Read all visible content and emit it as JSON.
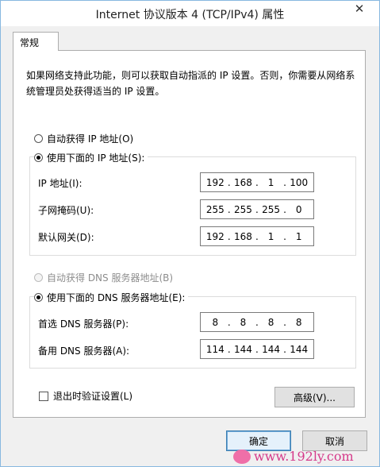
{
  "window": {
    "title": "Internet 协议版本 4 (TCP/IPv4) 属性",
    "close_glyph": "✕"
  },
  "tabs": [
    {
      "label": "常规",
      "active": true
    }
  ],
  "general": {
    "description": "如果网络支持此功能，则可以获取自动指派的 IP 设置。否则，你需要从网络系统管理员处获得适当的 IP 设置。",
    "ip_mode": {
      "auto_label": "自动获得 IP 地址(O)",
      "manual_label": "使用下面的 IP 地址(S):",
      "selected": "manual"
    },
    "ip_fields": [
      {
        "label": "IP 地址(I):",
        "octets": [
          "192",
          "168",
          "1",
          "100"
        ]
      },
      {
        "label": "子网掩码(U):",
        "octets": [
          "255",
          "255",
          "255",
          "0"
        ]
      },
      {
        "label": "默认网关(D):",
        "octets": [
          "192",
          "168",
          "1",
          "1"
        ]
      }
    ],
    "dns_mode": {
      "auto_label": "自动获得 DNS 服务器地址(B)",
      "manual_label": "使用下面的 DNS 服务器地址(E):",
      "selected": "manual",
      "auto_disabled": true
    },
    "dns_fields": [
      {
        "label": "首选 DNS 服务器(P):",
        "octets": [
          "8",
          "8",
          "8",
          "8"
        ]
      },
      {
        "label": "备用 DNS 服务器(A):",
        "octets": [
          "114",
          "144",
          "144",
          "144"
        ]
      }
    ],
    "validate_on_exit": {
      "label": "退出时验证设置(L)",
      "checked": false
    },
    "advanced_button": "高级(V)..."
  },
  "footer": {
    "ok_label": "确定",
    "cancel_label": "取消"
  },
  "watermark": {
    "text": "www.192ly.com"
  },
  "colors": {
    "window_border": "#88b8e0",
    "dialog_bg": "#f0f0f0",
    "default_button_border": "#3c7fb1",
    "watermark": "#d53a8a"
  }
}
